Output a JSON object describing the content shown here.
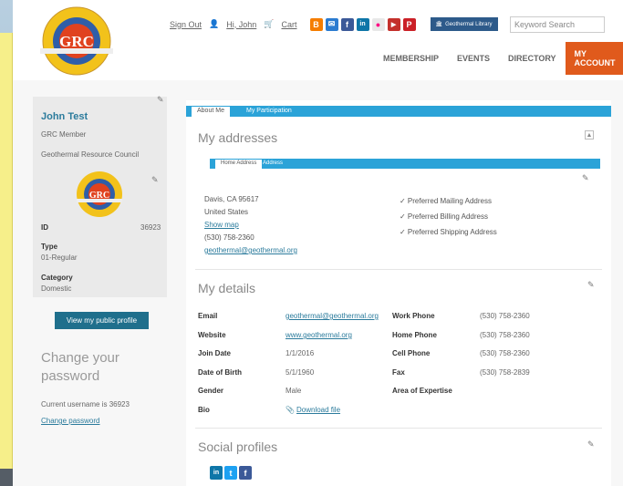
{
  "header": {
    "sign_out": "Sign Out",
    "hi_user": "Hi, John",
    "cart": "Cart",
    "geo_library": "Geothermal Library",
    "search_placeholder": "Keyword Search",
    "logo_text": "GRC",
    "logo_ring_text": "Geothermal Resources Council",
    "nav": [
      "MEMBERSHIP",
      "EVENTS",
      "DIRECTORY",
      "MY ACCOUNT"
    ],
    "social_icons": [
      {
        "icon": "blogger-icon",
        "color": "#f57d00",
        "glyph": "B"
      },
      {
        "icon": "email-icon",
        "color": "#2b7bd0",
        "glyph": "✉"
      },
      {
        "icon": "facebook-icon",
        "color": "#3b5998",
        "glyph": "f"
      },
      {
        "icon": "linkedin-icon",
        "color": "#0e76a8",
        "glyph": "in"
      },
      {
        "icon": "flickr-icon",
        "color": "#e8e8e8",
        "glyph": "●"
      },
      {
        "icon": "youtube-icon",
        "color": "#c4302b",
        "glyph": "▶"
      },
      {
        "icon": "pinterest-icon",
        "color": "#cb2027",
        "glyph": "P"
      }
    ]
  },
  "sidebar": {
    "name": "John Test",
    "member_type": "GRC Member",
    "org": "Geothermal Resource Council",
    "id_label": "ID",
    "id_value": "36923",
    "type_label": "Type",
    "type_value": "01-Regular",
    "category_label": "Category",
    "category_value": "Domestic",
    "profile_button": "View my public profile",
    "change_title": "Change your password",
    "current_username": "Current username is  36923",
    "change_link": "Change password"
  },
  "main": {
    "tabs": [
      "About Me",
      "My Participation"
    ],
    "addresses_title": "My addresses",
    "address_tabs": [
      "Home Address",
      "Address"
    ],
    "address_lines": [
      "Davis, CA 95617",
      "United States",
      "Show map",
      "(530) 758-2360",
      "geothermal@geothermal.org"
    ],
    "preferences": [
      "✓ Preferred Mailing Address",
      "✓ Preferred Billing Address",
      "✓ Preferred Shipping Address"
    ],
    "details_title": "My details",
    "details": [
      {
        "label": "Email",
        "value": "geothermal@geothermal.org",
        "label2": "Work Phone",
        "value2": "(530) 758-2360"
      },
      {
        "label": "Website",
        "value": "www.geothermal.org",
        "label2": "Home Phone",
        "value2": "(530) 758-2360"
      },
      {
        "label": "Join Date",
        "value": "1/1/2016",
        "label2": "Cell Phone",
        "value2": "(530) 758-2360"
      },
      {
        "label": "Date of Birth",
        "value": "5/1/1960",
        "label2": "Fax",
        "value2": "(530) 758-2839"
      },
      {
        "label": "Gender",
        "value": "Male",
        "label2": "Area of Expertise",
        "value2": ""
      },
      {
        "label": "Bio",
        "value": "Download file",
        "label2": "",
        "value2": ""
      }
    ],
    "social_title": "Social profiles"
  }
}
